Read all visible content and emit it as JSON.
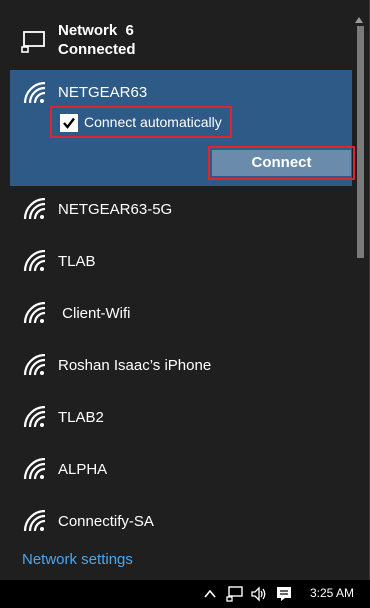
{
  "header": {
    "network_name": "Network  6",
    "status": "Connected"
  },
  "selected_network": {
    "ssid": "NETGEAR63",
    "connect_automatically_label": "Connect automatically",
    "connect_automatically_checked": true,
    "connect_button_label": "Connect"
  },
  "networks": [
    {
      "ssid": "NETGEAR63-5G"
    },
    {
      "ssid": "TLAB"
    },
    {
      "ssid": " Client-Wifi"
    },
    {
      "ssid": "Roshan Isaac’s iPhone"
    },
    {
      "ssid": "TLAB2"
    },
    {
      "ssid": "ALPHA"
    },
    {
      "ssid": "Connectify-SA"
    }
  ],
  "footer": {
    "settings_link": "Network settings"
  },
  "taskbar": {
    "time": "3:25 AM",
    "icons": [
      "chevron-up-icon",
      "network-icon",
      "volume-icon",
      "action-center-icon"
    ]
  },
  "colors": {
    "flyout_bg": "#1f1f1f",
    "selected_bg": "#2d5a86",
    "button_bg": "#6a8bab",
    "highlight_border": "#e0252e",
    "link": "#4aa6f0"
  }
}
